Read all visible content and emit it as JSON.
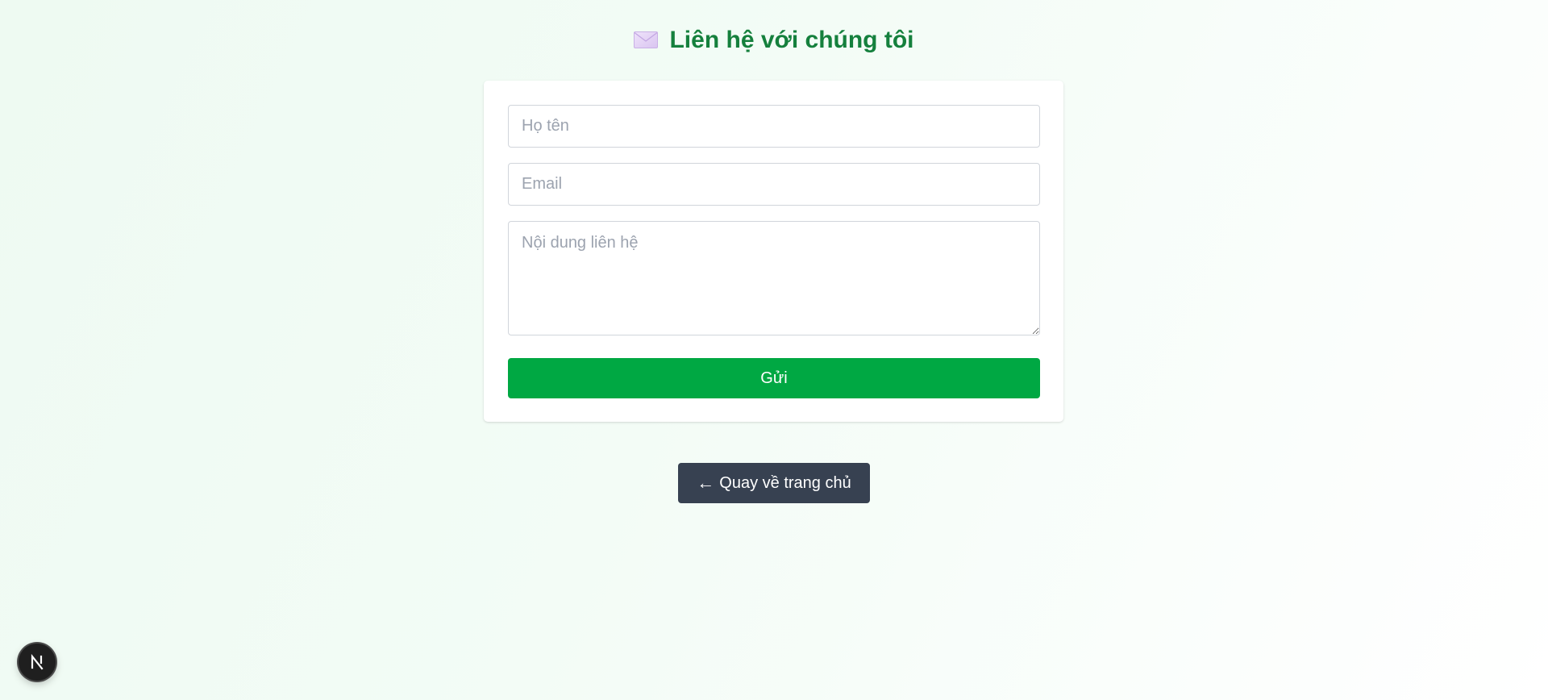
{
  "header": {
    "icon": "envelope-icon",
    "title": "Liên hệ với chúng tôi"
  },
  "form": {
    "name": {
      "placeholder": "Họ tên",
      "value": ""
    },
    "email": {
      "placeholder": "Email",
      "value": ""
    },
    "message": {
      "placeholder": "Nội dung liên hệ",
      "value": ""
    },
    "submit_label": "Gửi"
  },
  "back": {
    "arrow": "←",
    "label": "Quay về trang chủ"
  },
  "badge": {
    "icon": "nextjs-logo-icon"
  },
  "colors": {
    "title": "#15803d",
    "submit": "#00a843",
    "back": "#374151",
    "background_start": "#eefaf2",
    "background_end": "#ffffff"
  }
}
